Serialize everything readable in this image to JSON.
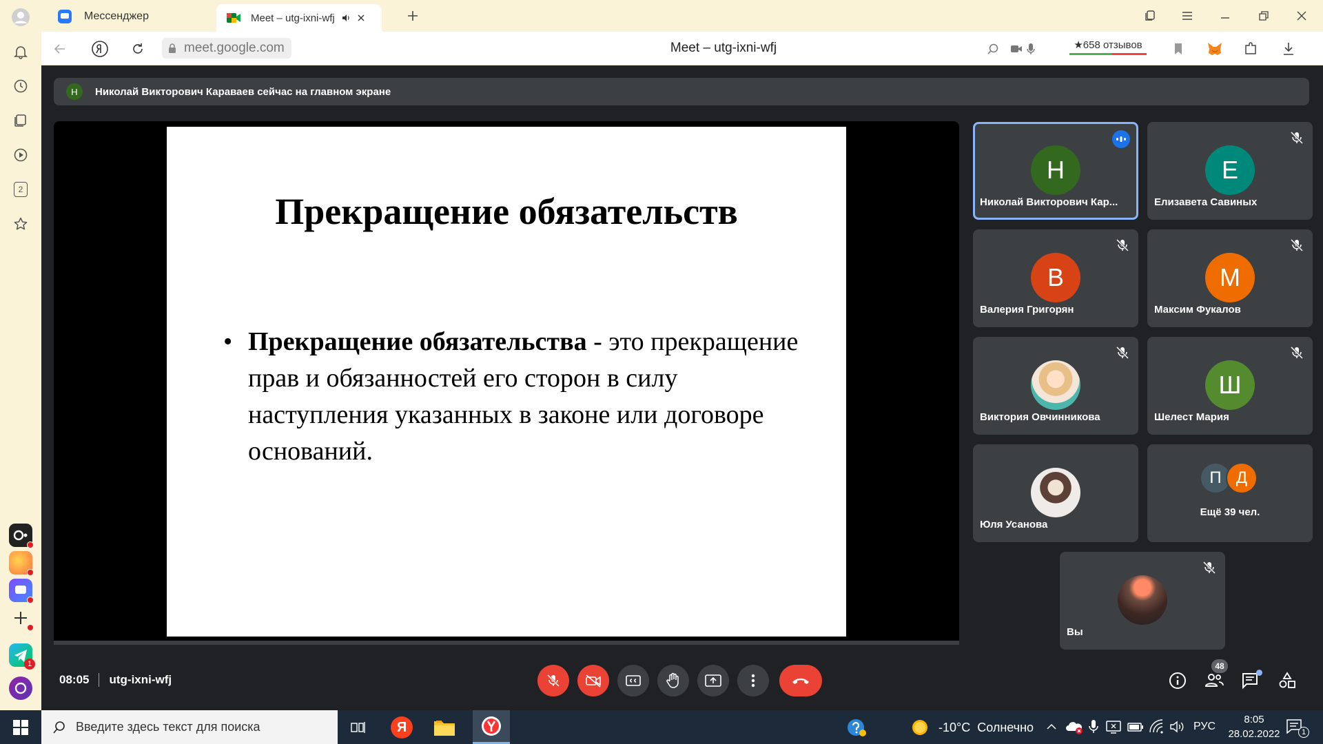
{
  "browser": {
    "tabs": [
      {
        "title": "Мессенджер",
        "icon": "messenger-icon"
      },
      {
        "title": "Meet – utg-ixni-wfj",
        "icon": "google-meet-icon",
        "audio_icon": "speaker-icon"
      }
    ],
    "address": "meet.google.com",
    "page_title": "Meet – utg-ixni-wfj",
    "reviews_label": "★658 отзывов"
  },
  "sidebar": {
    "items": [
      "avatar-icon",
      "bell-icon",
      "history-icon",
      "collections-icon",
      "video-icon",
      "tab-count-icon",
      "star-icon"
    ],
    "tab_count": "2",
    "apps": [
      "alice-app",
      "zen-app",
      "messenger-app",
      "add-app",
      "telegram-app",
      "alice-assistant"
    ],
    "telegram_badge": "1"
  },
  "meet": {
    "banner": {
      "initial": "Н",
      "text": "Николай Викторович Караваев сейчас на главном экране"
    },
    "slide": {
      "title": "Прекращение обязательств",
      "bullet_bold": "Прекращение обязательства",
      "bullet_rest": " - это прекращение прав и обязанностей его сторон в силу наступления указанных в законе или договоре оснований."
    },
    "participants": [
      {
        "name": "Николай Викторович Кар...",
        "initial": "Н",
        "color": "#33691e",
        "speaking": true
      },
      {
        "name": "Елизавета Савиных",
        "initial": "Е",
        "color": "#00897b"
      },
      {
        "name": "Валерия Григорян",
        "initial": "В",
        "color": "#d84315"
      },
      {
        "name": "Максим Фукалов",
        "initial": "М",
        "color": "#ef6c00"
      },
      {
        "name": "Виктория Овчинникова",
        "initial": "",
        "color": "#8d6e63"
      },
      {
        "name": "Шелест Мария",
        "initial": "Ш",
        "color": "#558b2f"
      },
      {
        "name": "Юля Усанова",
        "initial": "",
        "color": "#bcaaa4"
      },
      {
        "name": "Ещё 39 чел.",
        "initials": [
          "П",
          "Д"
        ]
      },
      {
        "name": "Вы",
        "initial": "",
        "color": "#4e342e"
      }
    ],
    "time": "08:05",
    "meeting_code": "utg-ixni-wfj",
    "people_count": "48"
  },
  "taskbar": {
    "search_placeholder": "Введите здесь текст для поиска",
    "weather": "-10°C  Солнечно",
    "lang": "РУС",
    "time": "8:05",
    "date": "28.02.2022",
    "notif_count": "1"
  },
  "colors": {
    "meet_bg": "#202124",
    "tile_bg": "#3c4043",
    "end_call": "#ea4335",
    "speaking_border": "#8ab4f8",
    "browser_bg": "#fbf3d7"
  }
}
